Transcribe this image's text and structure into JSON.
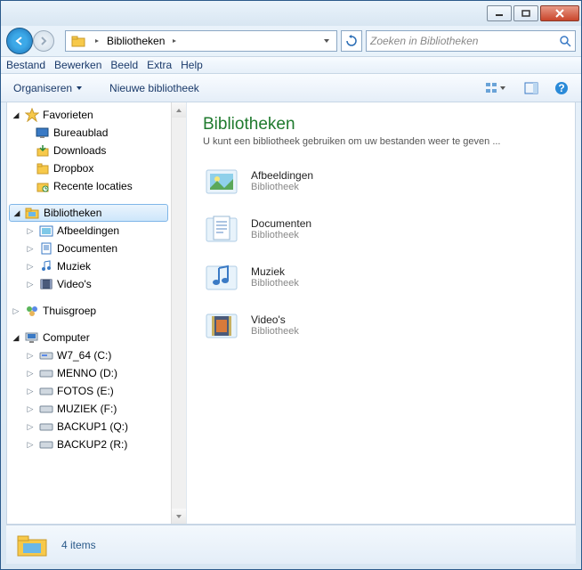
{
  "titlebar": {
    "minimize": "min",
    "maximize": "max",
    "close": "close"
  },
  "breadcrumb": {
    "location": "Bibliotheken"
  },
  "search": {
    "placeholder": "Zoeken in Bibliotheken"
  },
  "menubar": {
    "file": "Bestand",
    "edit": "Bewerken",
    "view": "Beeld",
    "extra": "Extra",
    "help": "Help"
  },
  "toolbar": {
    "organize": "Organiseren",
    "newlib": "Nieuwe bibliotheek"
  },
  "sidebar": {
    "favorites": {
      "label": "Favorieten",
      "items": [
        {
          "label": "Bureaublad"
        },
        {
          "label": "Downloads"
        },
        {
          "label": "Dropbox"
        },
        {
          "label": "Recente locaties"
        }
      ]
    },
    "libraries": {
      "label": "Bibliotheken",
      "items": [
        {
          "label": "Afbeeldingen"
        },
        {
          "label": "Documenten"
        },
        {
          "label": "Muziek"
        },
        {
          "label": "Video's"
        }
      ]
    },
    "homegroup": {
      "label": "Thuisgroep"
    },
    "computer": {
      "label": "Computer",
      "drives": [
        {
          "label": "W7_64 (C:)"
        },
        {
          "label": "MENNO (D:)"
        },
        {
          "label": "FOTOS (E:)"
        },
        {
          "label": "MUZIEK (F:)"
        },
        {
          "label": "BACKUP1 (Q:)"
        },
        {
          "label": "BACKUP2 (R:)"
        }
      ]
    }
  },
  "content": {
    "title": "Bibliotheken",
    "subtitle": "U kunt een bibliotheek gebruiken om uw bestanden weer te geven ...",
    "libs": [
      {
        "name": "Afbeeldingen",
        "kind": "Bibliotheek"
      },
      {
        "name": "Documenten",
        "kind": "Bibliotheek"
      },
      {
        "name": "Muziek",
        "kind": "Bibliotheek"
      },
      {
        "name": "Video's",
        "kind": "Bibliotheek"
      }
    ]
  },
  "statusbar": {
    "count": "4 items"
  }
}
